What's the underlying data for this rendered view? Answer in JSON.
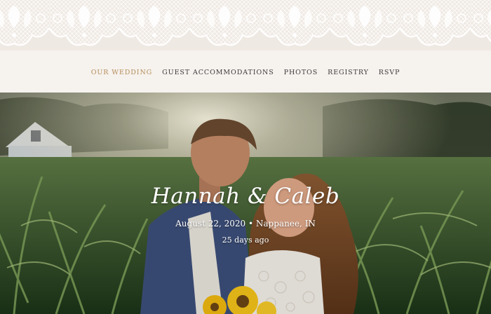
{
  "nav": {
    "items": [
      {
        "label": "OUR WEDDING",
        "active": true
      },
      {
        "label": "GUEST ACCOMMODATIONS",
        "active": false
      },
      {
        "label": "PHOTOS",
        "active": false
      },
      {
        "label": "REGISTRY",
        "active": false
      },
      {
        "label": "RSVP",
        "active": false
      }
    ],
    "active_color": "#b48d5a"
  },
  "hero": {
    "names": "Hannah & Caleb",
    "date": "August 22, 2020",
    "separator": "•",
    "location": "Nappanee, IN",
    "countdown": "25 days ago"
  }
}
